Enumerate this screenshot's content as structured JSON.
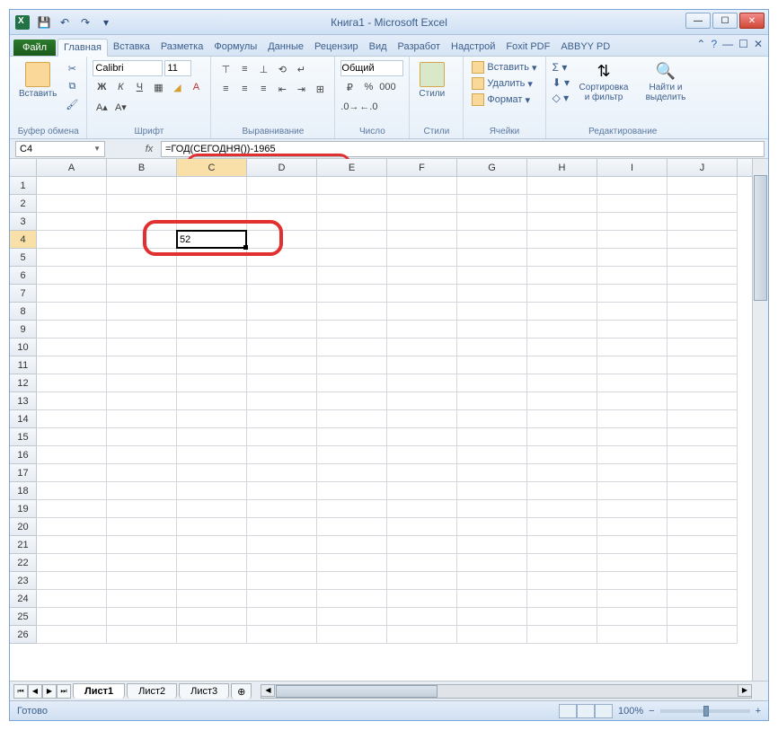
{
  "window": {
    "title": "Книга1 - Microsoft Excel"
  },
  "tabs": {
    "file": "Файл",
    "list": [
      "Главная",
      "Вставка",
      "Разметка",
      "Формулы",
      "Данные",
      "Рецензир",
      "Вид",
      "Разработ",
      "Надстрой",
      "Foxit PDF",
      "ABBYY PD"
    ],
    "active_index": 0
  },
  "ribbon": {
    "clipboard": {
      "paste": "Вставить",
      "title": "Буфер обмена"
    },
    "font": {
      "name": "Calibri",
      "size": "11",
      "title": "Шрифт"
    },
    "alignment": {
      "title": "Выравнивание"
    },
    "number": {
      "format": "Общий",
      "title": "Число"
    },
    "styles": {
      "label": "Стили",
      "title": "Стили"
    },
    "cells": {
      "insert": "Вставить",
      "delete": "Удалить",
      "format": "Формат",
      "title": "Ячейки"
    },
    "editing": {
      "sort": "Сортировка и фильтр",
      "find": "Найти и выделить",
      "title": "Редактирование"
    }
  },
  "namebox": {
    "value": "C4"
  },
  "formula_bar": {
    "value": "=ГОД(СЕГОДНЯ())-1965"
  },
  "columns": [
    "A",
    "B",
    "C",
    "D",
    "E",
    "F",
    "G",
    "H",
    "I",
    "J"
  ],
  "rows_count": 26,
  "active_cell": {
    "col": "C",
    "row": 4,
    "value": "52"
  },
  "sheets": {
    "list": [
      "Лист1",
      "Лист2",
      "Лист3"
    ],
    "active_index": 0
  },
  "statusbar": {
    "ready": "Готово",
    "zoom": "100%"
  }
}
